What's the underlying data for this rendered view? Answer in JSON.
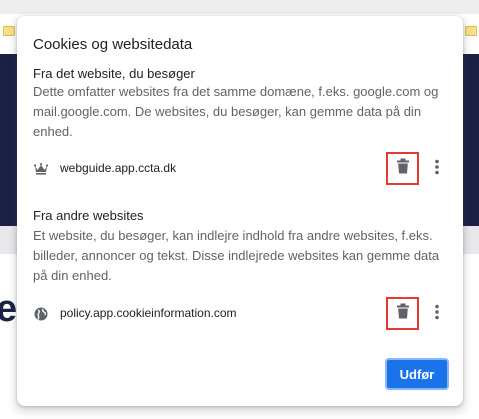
{
  "dialog": {
    "title": "Cookies og websitedata",
    "first_party": {
      "heading": "Fra det website, du besøger",
      "description": "Dette omfatter websites fra det samme domæne, f.eks. google.com og mail.google.com. De websites, du besøger, kan gemme data på din enhed.",
      "sites": [
        {
          "name": "webguide.app.ccta.dk",
          "icon": "crown-icon"
        }
      ]
    },
    "third_party": {
      "heading": "Fra andre websites",
      "description": "Et website, du besøger, kan indlejre indhold fra andre websites, f.eks. billeder, annoncer og tekst. Disse indlejrede websites kan gemme data på din enhed.",
      "sites": [
        {
          "name": "policy.app.cookieinformation.com",
          "icon": "globe-icon"
        }
      ]
    },
    "done_label": "Udfør"
  },
  "background": {
    "partial_text": "e"
  },
  "colors": {
    "accent": "#1a73e8",
    "highlight_border": "#e53935",
    "page_navy": "#1b2146"
  }
}
